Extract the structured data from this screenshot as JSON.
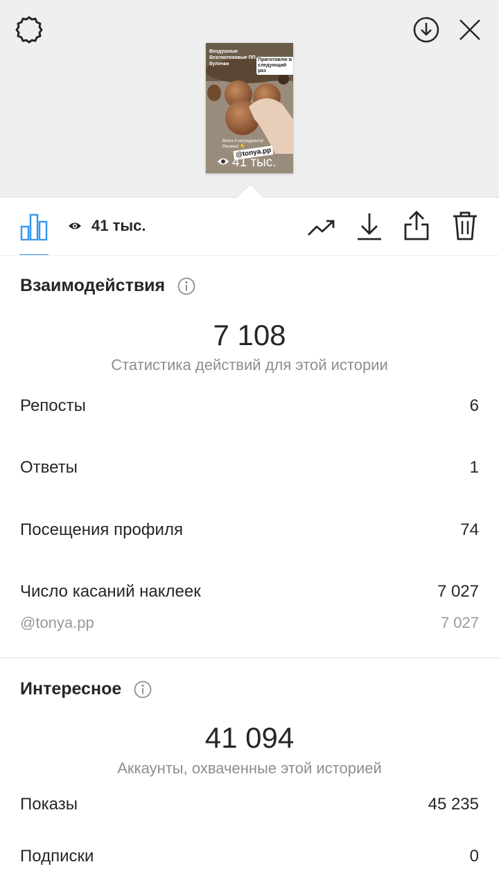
{
  "story": {
    "caption_main": "Воздушные безглютеновые ПП булочки",
    "caption_sticker": "Приготовлю в следующий раз",
    "caption_bottom": "Всего 4 ингредиента! Решено! 👇",
    "mention_sticker": "@tonya.pp",
    "views_overlay": "41 тыс."
  },
  "toolbar": {
    "views": "41 тыс."
  },
  "interactions": {
    "title": "Взаимодействия",
    "total": "7 108",
    "subtitle": "Статистика действий для этой истории",
    "rows": [
      {
        "label": "Репосты",
        "value": "6"
      },
      {
        "label": "Ответы",
        "value": "1"
      },
      {
        "label": "Посещения профиля",
        "value": "74"
      },
      {
        "label": "Число касаний наклеек",
        "value": "7 027"
      }
    ],
    "sticker_row": {
      "label": "@tonya.pp",
      "value": "7 027"
    }
  },
  "discovery": {
    "title": "Интересное",
    "total": "41 094",
    "subtitle": "Аккаунты, охваченные этой историей",
    "rows": [
      {
        "label": "Показы",
        "value": "45 235"
      },
      {
        "label": "Подписки",
        "value": "0"
      }
    ]
  },
  "colors": {
    "accent": "#3897f0",
    "text": "#262626",
    "secondary": "#8e8e8e",
    "header_bg": "#efefef"
  },
  "icons": [
    "settings-icon",
    "download-circle-icon",
    "close-icon",
    "bar-chart-icon",
    "eye-icon",
    "trending-icon",
    "download-icon",
    "share-icon",
    "trash-icon",
    "info-icon"
  ]
}
